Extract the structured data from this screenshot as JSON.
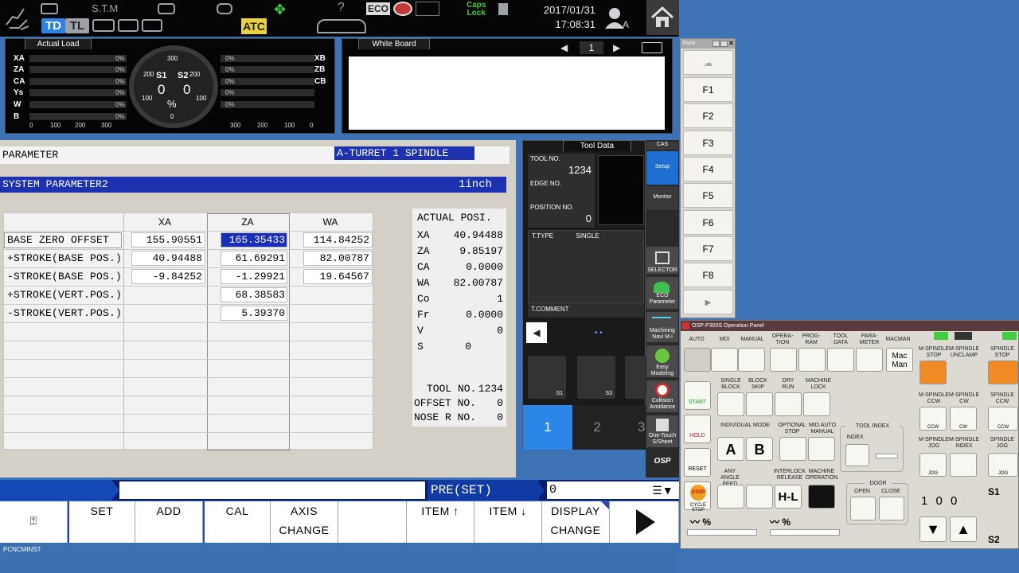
{
  "topbar": {
    "stm": "S.T.M",
    "td": "TD",
    "tl": "TL",
    "atc": "ATC",
    "eco": "ECO",
    "caps_lock": [
      "Caps",
      "Lock"
    ],
    "date": "2017/01/31",
    "time": "17:08:31",
    "user_suffix": "A",
    "help": "?"
  },
  "actual_load": {
    "title": "Actual Load",
    "left_axes": [
      "XA",
      "ZA",
      "CA",
      "Ys",
      "W",
      "B"
    ],
    "left_pcts": [
      "0%",
      "0%",
      "0%",
      "0%",
      "0%",
      "0%"
    ],
    "left_scale": [
      "0",
      "100",
      "200",
      "300"
    ],
    "right_axes": [
      "XB",
      "ZB",
      "CB"
    ],
    "right_pcts": [
      "0%",
      "0%",
      "0%",
      "0%",
      "0%"
    ],
    "right_scale": [
      "300",
      "200",
      "100",
      "0"
    ],
    "gauge": {
      "top": "300",
      "left": "200",
      "right": "200",
      "lower_left": "100",
      "lower_right": "100",
      "bottom": "0",
      "s1_label": "S1",
      "s2_label": "S2",
      "s1_value": "0",
      "s2_value": "0",
      "unit": "%"
    }
  },
  "whiteboard": {
    "title": "White Board",
    "page": "1"
  },
  "parameter": {
    "title": "PARAMETER",
    "turret": "A-TURRET   1 SPINDLE",
    "section": "SYSTEM PARAMETER2",
    "unit": "1inch",
    "columns": [
      "XA",
      "ZA",
      "WA"
    ],
    "rows": [
      {
        "label": "BASE ZERO OFFSET",
        "xa": "155.90551",
        "za": "165.35433",
        "wa": "114.84252"
      },
      {
        "label": "+STROKE(BASE POS.)",
        "xa": "40.94488",
        "za": "61.69291",
        "wa": "82.00787"
      },
      {
        "label": "-STROKE(BASE POS.)",
        "xa": "-9.84252",
        "za": "-1.29921",
        "wa": "19.64567"
      },
      {
        "label": "+STROKE(VERT.POS.)",
        "xa": "",
        "za": "68.38583",
        "wa": ""
      },
      {
        "label": "-STROKE(VERT.POS.)",
        "xa": "",
        "za": "5.39370",
        "wa": ""
      }
    ],
    "actual_posi": {
      "title": "ACTUAL POSI.",
      "items": [
        {
          "label": "XA",
          "value": "40.94488"
        },
        {
          "label": "ZA",
          "value": "9.85197"
        },
        {
          "label": "CA",
          "value": "0.0000"
        },
        {
          "label": "WA",
          "value": "82.00787"
        },
        {
          "label": "Co",
          "value": "1"
        },
        {
          "label": "Fr",
          "value": "0.0000"
        },
        {
          "label": "V",
          "value": "0"
        },
        {
          "label": "S",
          "value": "0"
        }
      ],
      "tool_no_label": "TOOL NO.",
      "tool_no": "1234",
      "offset_no_label": "OFFSET NO.",
      "offset_no": "0",
      "nose_r_label": "NOSE R NO.",
      "nose_r": "0"
    }
  },
  "tool_data": {
    "title": "Tool Data",
    "tool_no_label": "TOOL NO.",
    "tool_no": "1234",
    "edge_no_label": "EDGE NO.",
    "position_no_label": "POSITION NO.",
    "position_no": "0",
    "t_type_label": "T.TYPE",
    "t_type": "SINGLE",
    "t_comment_label": "T.COMMENT",
    "tab1": "1",
    "tab2": "2",
    "tab3": "3",
    "s1": "S1",
    "s3": "S3"
  },
  "sidebar": {
    "cas": "CAS",
    "setup": "Setup",
    "monitor": "Monitor",
    "selector": "SELECTOR",
    "eco_param": [
      "ECO",
      "Parameter"
    ],
    "machining_navi": [
      "Machining",
      "Navi M-i"
    ],
    "easy_modeling": [
      "Easy",
      "Modeling"
    ],
    "collision": [
      "Collision",
      "Avoidance"
    ],
    "one_touch": [
      "One-Touch",
      "S/Sheet"
    ],
    "osp": "OSP"
  },
  "input": {
    "mode": "PRE(SET)",
    "value": "0"
  },
  "softkeys": [
    {
      "l1": "SET",
      "l2": ""
    },
    {
      "l1": "ADD",
      "l2": ""
    },
    {
      "l1": "CAL",
      "l2": ""
    },
    {
      "l1": "AXIS",
      "l2": "CHANGE"
    },
    {
      "l1": "",
      "l2": ""
    },
    {
      "l1": "ITEM ↑",
      "l2": ""
    },
    {
      "l1": "ITEM ↓",
      "l2": ""
    },
    {
      "l1": "DISPLAY",
      "l2": "CHANGE"
    }
  ],
  "status_line": "PCNCMINST",
  "func_window": {
    "title": "Func",
    "keys": [
      "F1",
      "F2",
      "F3",
      "F4",
      "F5",
      "F6",
      "F7",
      "F8"
    ]
  },
  "op_panel": {
    "title": "OSP-P300S Operation Panel",
    "modes": [
      "AUTO",
      "MDI",
      "MANUAL",
      "OPERA-TION",
      "PROG-RAM",
      "TOOL DATA",
      "PARA-METER",
      "MACMAN"
    ],
    "macman": [
      "Mac",
      "Man"
    ],
    "start": "START",
    "hold": "HOLD",
    "reset": "RESET",
    "stop": "STOP",
    "cyclestop": "CYCLE STOP",
    "single_block": "SINGLE BLOCK",
    "block_skip": "BLOCK SKIP",
    "dry_run": "DRY RUN",
    "machine_lock": "MACHINE LOCK",
    "individual_mode": "INDIVIDUAL MODE",
    "optional_stop": "OPTIONAL STOP",
    "mid_auto_manual": "MID.AUTO MANUAL",
    "tool_index": "TOOL INDEX",
    "index": "INDEX",
    "any_angle_feed": "ANY ANGLE FEED",
    "interlock_release": "INTERLOCK RELEASE",
    "machine_operation": "MACHINE OPERATION",
    "door": "DOOR",
    "open": "OPEN",
    "close": "CLOSE",
    "m_spindle_stop": "M-SPINDLE STOP",
    "m_spindle_unclamp": "M-SPINDLE UNCLAMP",
    "spindle_stop": "SPINDLE STOP",
    "m_spindle_ccw": "M-SPINDLE CCW",
    "m_spindle_cw": "M-SPINDLE CW",
    "spindle_ccw": "SPINDLE CCW",
    "m_spindle_jog": "M-SPINDLE JOG",
    "m_spindle_index": "M-SPINDLE INDEX",
    "spindle_jog": "SPINDLE JOG",
    "ccw": "CCW",
    "cw": "CW",
    "jog": "JOG",
    "hundred": [
      "1",
      "0",
      "0"
    ],
    "pct": "%",
    "s1": "S1",
    "s2": "S2",
    "a": "A",
    "b": "B",
    "hl": "H-L"
  }
}
